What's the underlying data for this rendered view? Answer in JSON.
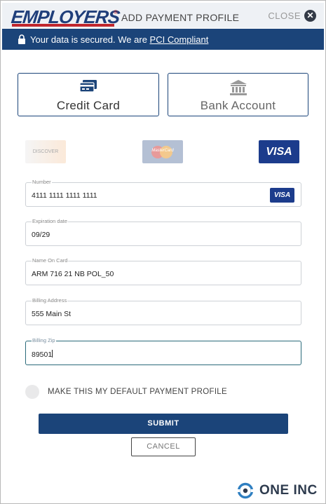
{
  "header": {
    "logo_text": "EMPLOYERS",
    "logo_mark": "®",
    "title": "ADD PAYMENT PROFILE",
    "close_label": "CLOSE",
    "close_icon": "close-circle-icon"
  },
  "security_banner": {
    "text": "Your data is secured. We are ",
    "link_text": "PCI Compliant",
    "icon": "lock-icon"
  },
  "payment_tabs": [
    {
      "label": "Credit Card",
      "icon": "credit-card-icon",
      "selected": true
    },
    {
      "label": "Bank Account",
      "icon": "bank-icon",
      "selected": false
    }
  ],
  "card_brands": {
    "discover": "DISCOVER",
    "mastercard": "MasterCard",
    "visa": "VISA"
  },
  "fields": {
    "number": {
      "label": "Number",
      "value": "4111 1111 1111 1111",
      "brand_badge": "VISA"
    },
    "expiration": {
      "label": "Expiration date",
      "value": "09/29"
    },
    "name": {
      "label": "Name On Card",
      "value": "ARM 716 21 NB POL_50"
    },
    "address": {
      "label": "Billing Address",
      "value": "555 Main St"
    },
    "zip": {
      "label": "Billing Zip",
      "value": "89501"
    }
  },
  "default_profile": {
    "label": "MAKE THIS MY DEFAULT PAYMENT PROFILE",
    "checked": false
  },
  "actions": {
    "submit_label": "SUBMIT",
    "cancel_label": "CANCEL"
  },
  "footer": {
    "brand": "ONE INC",
    "icon": "one-inc-logo-icon"
  },
  "colors": {
    "primary": "#1b4479",
    "visa_blue": "#1c3c8c",
    "brand_red": "#c0262d"
  }
}
